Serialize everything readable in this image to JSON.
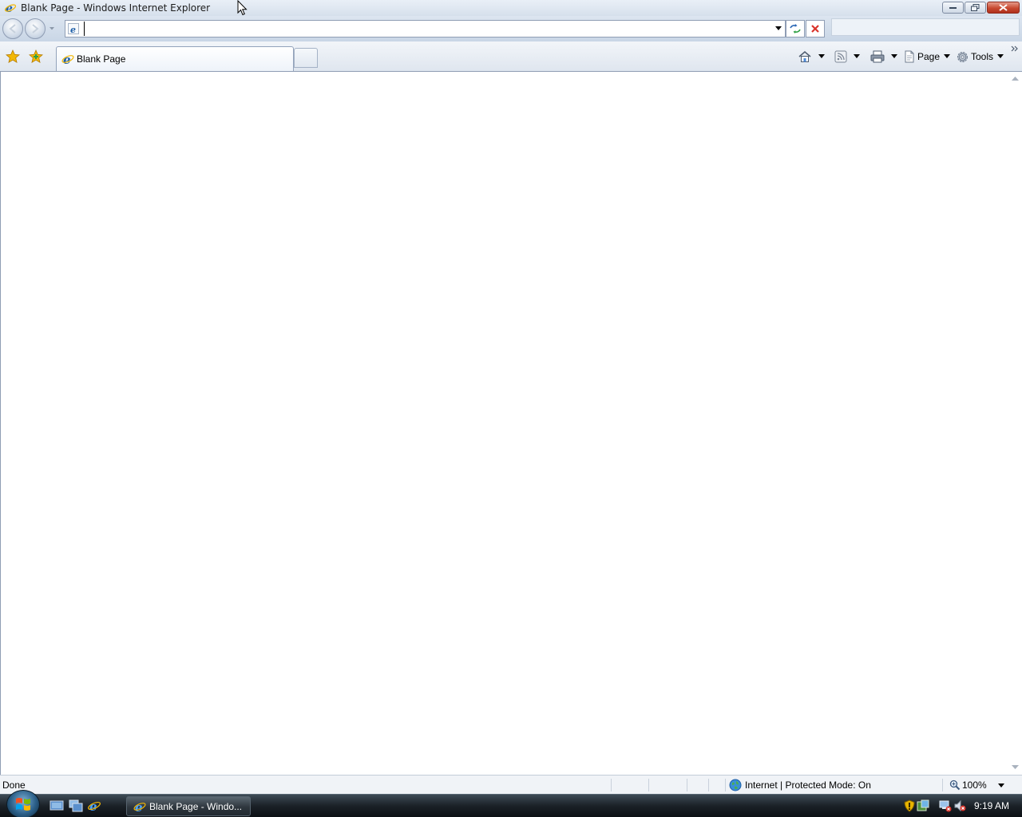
{
  "window": {
    "title": "Blank Page - Windows Internet Explorer",
    "minimize_icon": "minimize-icon",
    "maximize_icon": "restore-icon",
    "close_icon": "close-icon"
  },
  "nav": {
    "address_value": "",
    "search_placeholder": ""
  },
  "tabs": [
    {
      "label": "Blank Page",
      "active": true
    }
  ],
  "commandbar": {
    "page_label": "Page",
    "tools_label": "Tools"
  },
  "status": {
    "text": "Done",
    "zone": "Internet | Protected Mode: On",
    "zoom": "100%"
  },
  "taskbar": {
    "task_label": "Blank Page - Windo...",
    "clock": "9:19 AM"
  },
  "colors": {
    "accent": "#1e5fa8",
    "close_red": "#c84a31",
    "stop_red": "#d9332a",
    "star_yellow": "#f2b705"
  }
}
